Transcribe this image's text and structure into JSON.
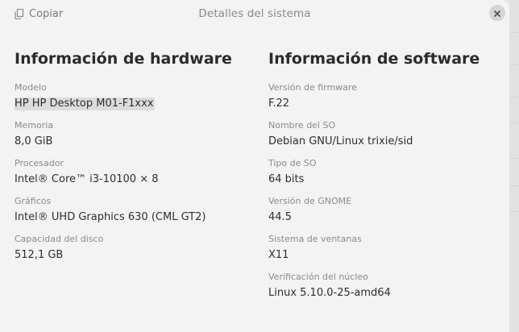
{
  "window": {
    "title": "Detalles del sistema",
    "copy_label": "Copiar"
  },
  "icons": {
    "copy": "copy-icon",
    "close": "close-icon"
  },
  "hardware": {
    "title": "Información de hardware",
    "fields": [
      {
        "label": "Modelo",
        "value": "HP HP Desktop M01-F1xxx"
      },
      {
        "label": "Memoria",
        "value": "8,0 GiB"
      },
      {
        "label": "Procesador",
        "value": "Intel® Core™ i3-10100 × 8"
      },
      {
        "label": "Gráficos",
        "value": "Intel® UHD Graphics 630 (CML GT2)"
      },
      {
        "label": "Capacidad del disco",
        "value": "512,1 GB"
      }
    ]
  },
  "software": {
    "title": "Información de software",
    "fields": [
      {
        "label": "Versión de firmware",
        "value": "F.22"
      },
      {
        "label": "Nombre del SO",
        "value": "Debian GNU/Linux trixie/sid"
      },
      {
        "label": "Tipo de SO",
        "value": "64 bits"
      },
      {
        "label": "Versión de GNOME",
        "value": "44.5"
      },
      {
        "label": "Sistema de ventanas",
        "value": "X11"
      },
      {
        "label": "Verificación del núcleo",
        "value": "Linux 5.10.0-25-amd64"
      }
    ]
  }
}
